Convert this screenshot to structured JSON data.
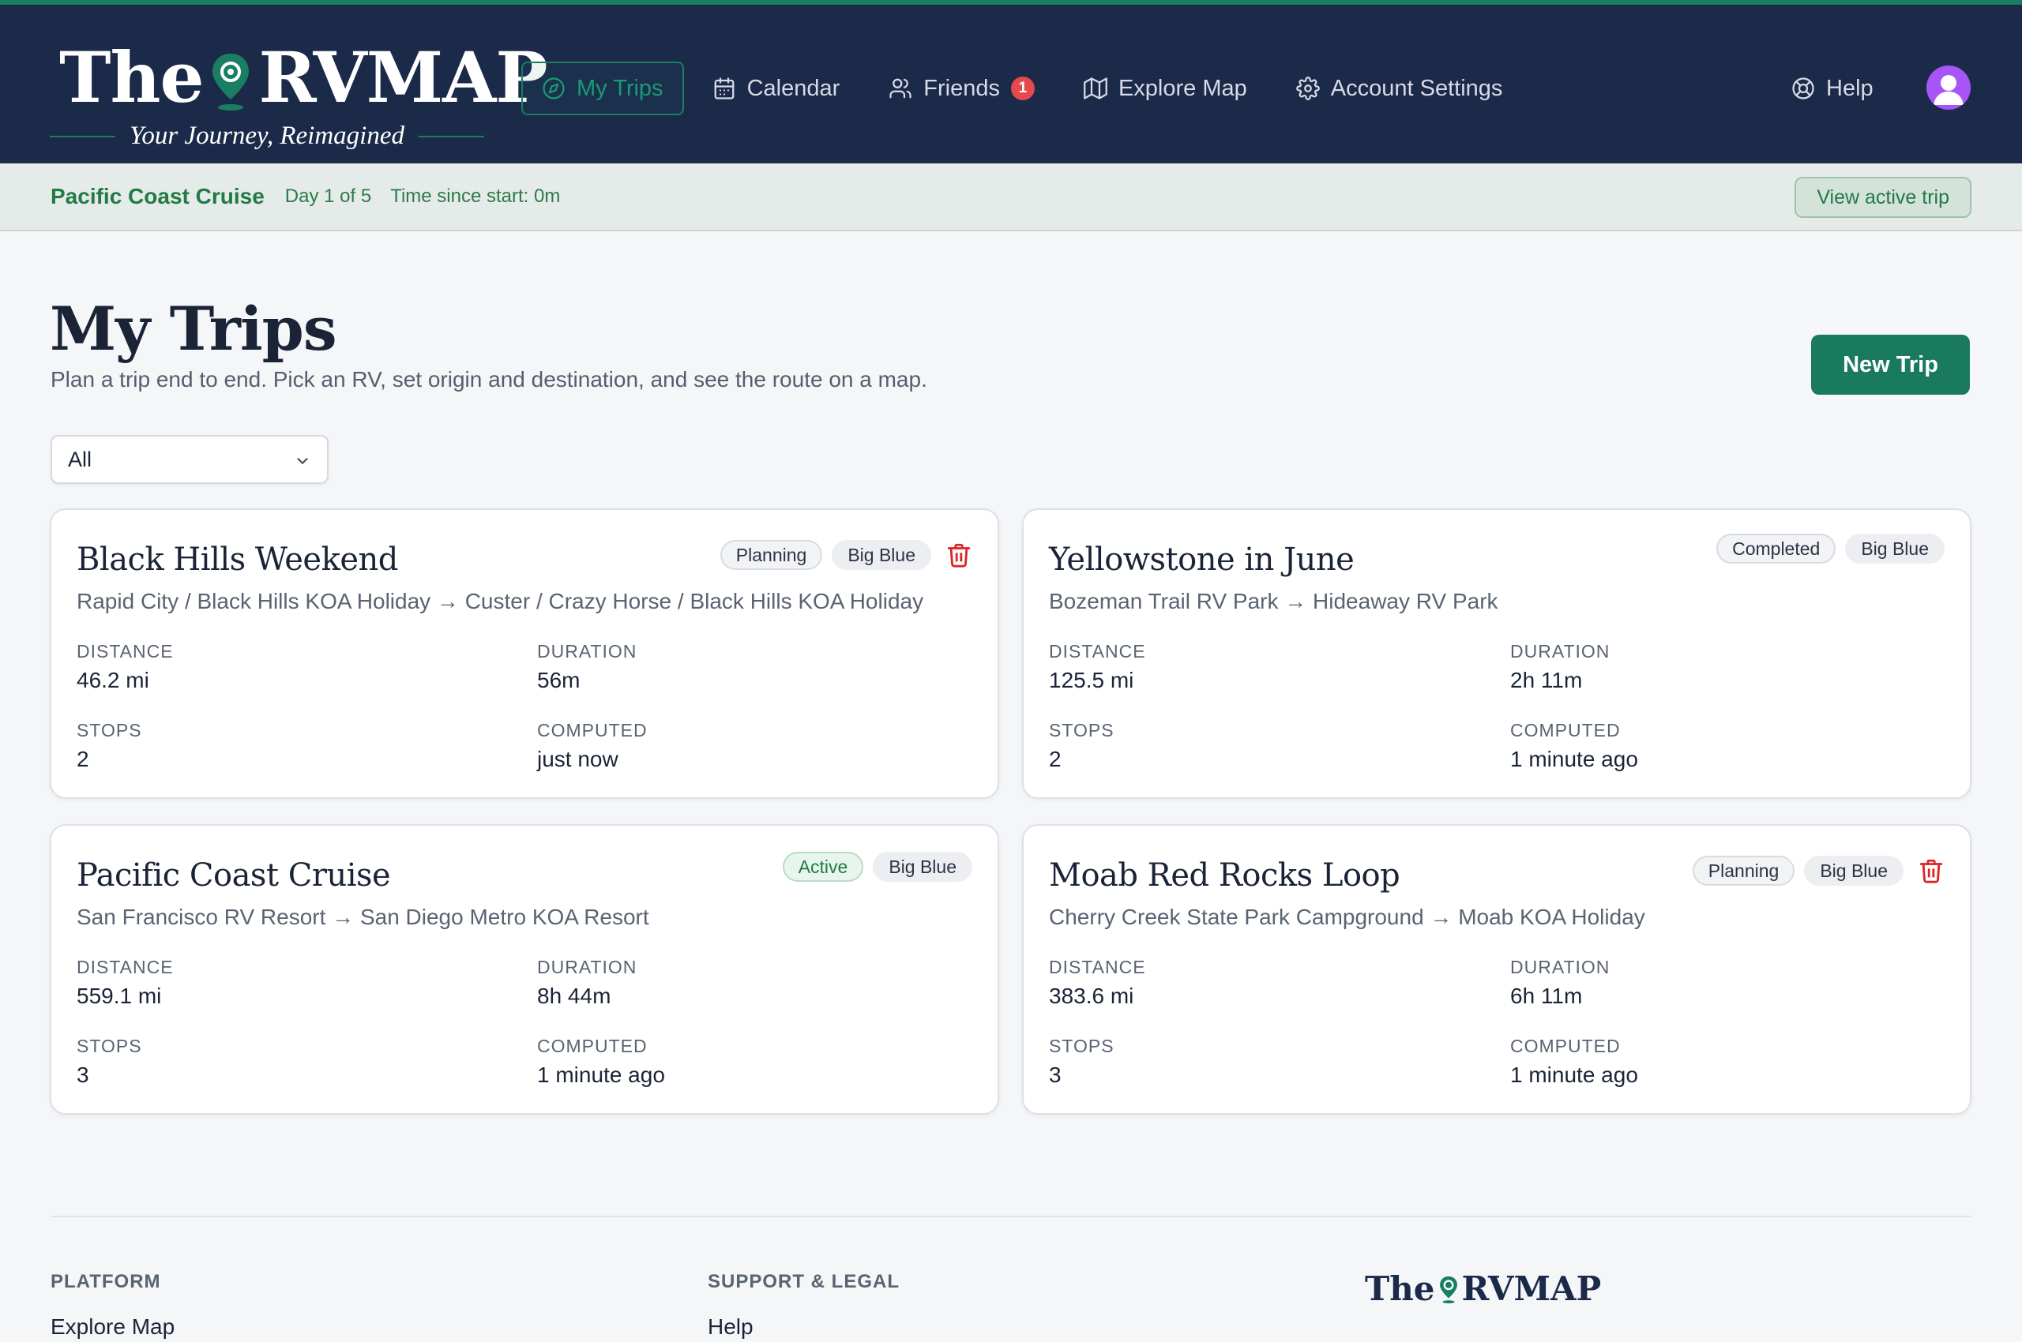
{
  "brand": {
    "word_left": "The",
    "word_right": "RVMAP",
    "tagline": "Your Journey, Reimagined",
    "green": "#1a7f62",
    "navy": "#1c2a4a"
  },
  "nav": {
    "items": [
      {
        "label": "My Trips",
        "icon": "compass-icon",
        "active": true
      },
      {
        "label": "Calendar",
        "icon": "calendar-icon"
      },
      {
        "label": "Friends",
        "icon": "users-icon",
        "badge": "1"
      },
      {
        "label": "Explore Map",
        "icon": "map-icon"
      },
      {
        "label": "Account Settings",
        "icon": "gear-icon"
      }
    ],
    "help": "Help"
  },
  "banner": {
    "trip_name": "Pacific Coast Cruise",
    "day": "Day 1 of 5",
    "time_since": "Time since start: 0m",
    "button": "View active trip"
  },
  "page": {
    "title": "My Trips",
    "subtitle": "Plan a trip end to end. Pick an RV, set origin and destination, and see the route on a map.",
    "new_trip": "New Trip",
    "filter_value": "All"
  },
  "labels": {
    "distance": "DISTANCE",
    "duration": "DURATION",
    "stops": "STOPS",
    "computed": "COMPUTED"
  },
  "trips": [
    {
      "title": "Black Hills Weekend",
      "route": "Rapid City / Black Hills KOA Holiday → Custer / Crazy Horse / Black Hills KOA Holiday",
      "status": "Planning",
      "rv": "Big Blue",
      "distance": "46.2 mi",
      "duration": "56m",
      "stops": "2",
      "computed": "just now"
    },
    {
      "title": "Yellowstone in June",
      "route": "Bozeman Trail RV Park → Hideaway RV Park",
      "status": "Completed",
      "rv": "Big Blue",
      "distance": "125.5 mi",
      "duration": "2h 11m",
      "stops": "2",
      "computed": "1 minute ago"
    },
    {
      "title": "Pacific Coast Cruise",
      "route": "San Francisco RV Resort → San Diego Metro KOA Resort",
      "status": "Active",
      "rv": "Big Blue",
      "distance": "559.1 mi",
      "duration": "8h 44m",
      "stops": "3",
      "computed": "1 minute ago"
    },
    {
      "title": "Moab Red Rocks Loop",
      "route": "Cherry Creek State Park Campground → Moab KOA Holiday",
      "status": "Planning",
      "rv": "Big Blue",
      "distance": "383.6 mi",
      "duration": "6h 11m",
      "stops": "3",
      "computed": "1 minute ago"
    }
  ],
  "footer": {
    "platform_heading": "PLATFORM",
    "platform_link": "Explore Map",
    "support_heading": "SUPPORT & LEGAL",
    "support_link": "Help",
    "logo_left": "The",
    "logo_right": "RVMAP"
  }
}
